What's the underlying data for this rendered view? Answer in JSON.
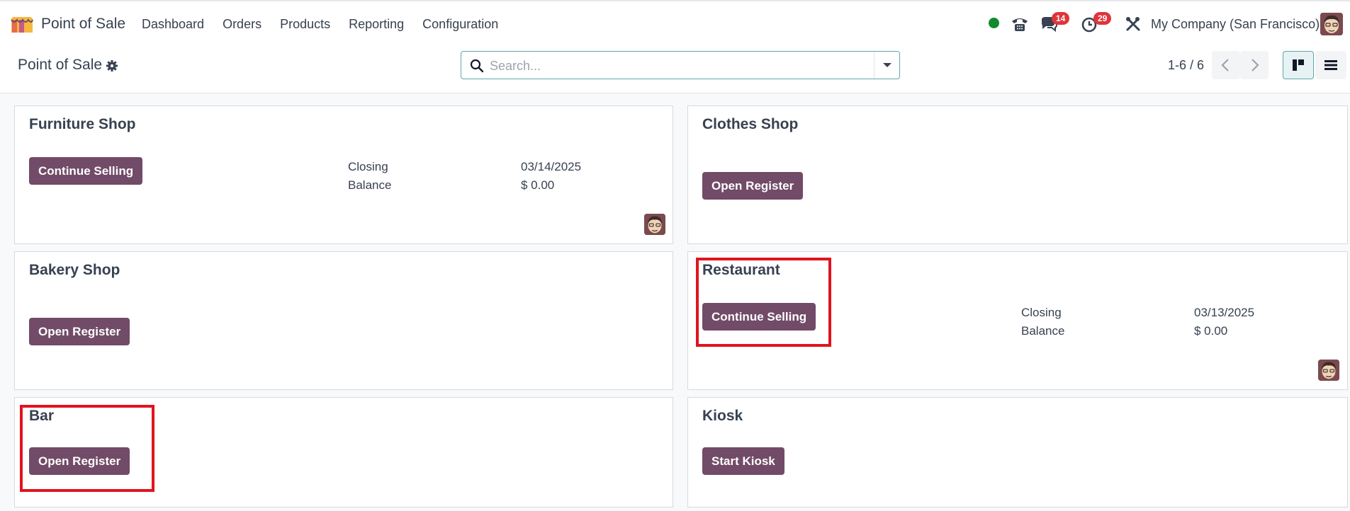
{
  "nav": {
    "app_name": "Point of Sale",
    "menu": [
      "Dashboard",
      "Orders",
      "Products",
      "Reporting",
      "Configuration"
    ],
    "messages_count": "14",
    "activities_count": "29",
    "company": "My Company (San Francisco)"
  },
  "control": {
    "title": "Point of Sale",
    "search_placeholder": "Search...",
    "pager": "1-6 / 6"
  },
  "cards": [
    {
      "name": "Furniture Shop",
      "button": "Continue Selling",
      "closing_label": "Closing",
      "closing_value": "03/14/2025",
      "balance_label": "Balance",
      "balance_value": "$ 0.00"
    },
    {
      "name": "Clothes Shop",
      "button": "Open Register"
    },
    {
      "name": "Bakery Shop",
      "button": "Open Register"
    },
    {
      "name": "Restaurant",
      "button": "Continue Selling",
      "closing_label": "Closing",
      "closing_value": "03/13/2025",
      "balance_label": "Balance",
      "balance_value": "$ 0.00"
    },
    {
      "name": "Bar",
      "button": "Open Register"
    },
    {
      "name": "Kiosk",
      "button": "Start Kiosk"
    }
  ],
  "colors": {
    "brand": "#714b67",
    "highlight": "#e0141e",
    "online": "#0f8a2e",
    "badge": "#e0343c"
  }
}
